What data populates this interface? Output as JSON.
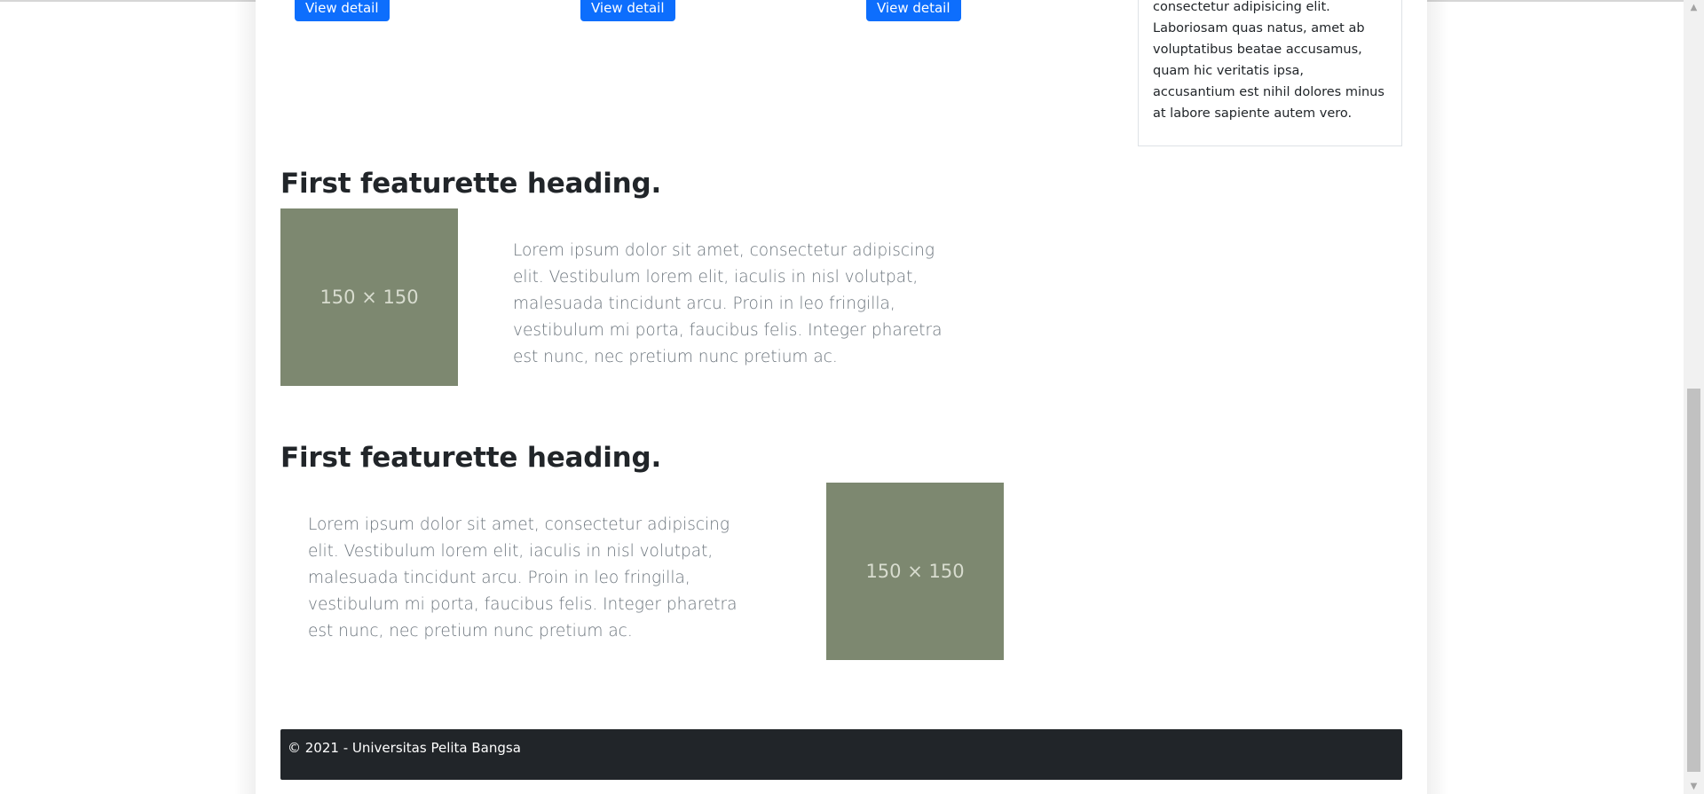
{
  "cards": {
    "buttons": [
      "View detail",
      "View detail",
      "View detail"
    ]
  },
  "sidebar": {
    "text": "consectetur adipisicing elit. Laboriosam quas natus, amet ab voluptatibus beatae accusamus, quam hic veritatis ipsa, accusantium est nihil dolores minus at labore sapiente autem vero."
  },
  "featurettes": [
    {
      "heading": "First featurette heading.",
      "image_label": "150 × 150",
      "text": "Lorem ipsum dolor sit amet, consectetur adipiscing elit. Vestibulum lorem elit, iaculis in nisl volutpat, malesuada tincidunt arcu. Proin in leo fringilla, vestibulum mi porta, faucibus felis. Integer pharetra est nunc, nec pretium nunc pretium ac."
    },
    {
      "heading": "First featurette heading.",
      "image_label": "150 × 150",
      "text": "Lorem ipsum dolor sit amet, consectetur adipiscing elit. Vestibulum lorem elit, iaculis in nisl volutpat, malesuada tincidunt arcu. Proin in leo fringilla, vestibulum mi porta, faucibus felis. Integer pharetra est nunc, nec pretium nunc pretium ac."
    }
  ],
  "footer": {
    "text": "© 2021 - Universitas Pelita Bangsa"
  },
  "scrollbar": {
    "up_icon": "triangle-up",
    "down_icon": "triangle-down"
  },
  "colors": {
    "primary": "#0d6efd",
    "placeholder": "#7d8870",
    "footer_bg": "#212529",
    "lead_text": "#6c757d"
  }
}
